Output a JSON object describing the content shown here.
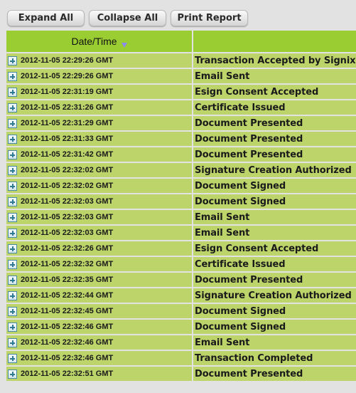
{
  "toolbar": {
    "expand_all": "Expand All",
    "collapse_all": "Collapse All",
    "print_report": "Print Report"
  },
  "table": {
    "columns": [
      {
        "label": "Date/Time",
        "sort": "descending",
        "sort_icon": "sort-down-icon"
      },
      {
        "label": ""
      }
    ],
    "rows": [
      {
        "datetime": "2012-11-05 22:29:26 GMT",
        "event": "Transaction Accepted by Signix"
      },
      {
        "datetime": "2012-11-05 22:29:26 GMT",
        "event": "Email Sent"
      },
      {
        "datetime": "2012-11-05 22:31:19 GMT",
        "event": "Esign Consent Accepted"
      },
      {
        "datetime": "2012-11-05 22:31:26 GMT",
        "event": "Certificate Issued"
      },
      {
        "datetime": "2012-11-05 22:31:29 GMT",
        "event": "Document Presented"
      },
      {
        "datetime": "2012-11-05 22:31:33 GMT",
        "event": "Document Presented"
      },
      {
        "datetime": "2012-11-05 22:31:42 GMT",
        "event": "Document Presented"
      },
      {
        "datetime": "2012-11-05 22:32:02 GMT",
        "event": "Signature Creation Authorized"
      },
      {
        "datetime": "2012-11-05 22:32:02 GMT",
        "event": "Document Signed"
      },
      {
        "datetime": "2012-11-05 22:32:03 GMT",
        "event": "Document Signed"
      },
      {
        "datetime": "2012-11-05 22:32:03 GMT",
        "event": "Email Sent"
      },
      {
        "datetime": "2012-11-05 22:32:03 GMT",
        "event": "Email Sent"
      },
      {
        "datetime": "2012-11-05 22:32:26 GMT",
        "event": "Esign Consent Accepted"
      },
      {
        "datetime": "2012-11-05 22:32:32 GMT",
        "event": "Certificate Issued"
      },
      {
        "datetime": "2012-11-05 22:32:35 GMT",
        "event": "Document Presented"
      },
      {
        "datetime": "2012-11-05 22:32:44 GMT",
        "event": "Signature Creation Authorized"
      },
      {
        "datetime": "2012-11-05 22:32:45 GMT",
        "event": "Document Signed"
      },
      {
        "datetime": "2012-11-05 22:32:46 GMT",
        "event": "Document Signed"
      },
      {
        "datetime": "2012-11-05 22:32:46 GMT",
        "event": "Email Sent"
      },
      {
        "datetime": "2012-11-05 22:32:46 GMT",
        "event": "Transaction Completed"
      },
      {
        "datetime": "2012-11-05 22:32:51 GMT",
        "event": "Document Presented"
      }
    ]
  },
  "colors": {
    "header_green": "#9acd32",
    "row_green": "#bdd46a",
    "background": "#e2e2e2",
    "sort_arrow": "#8a8aef",
    "expand_icon": "#2f7a92"
  }
}
